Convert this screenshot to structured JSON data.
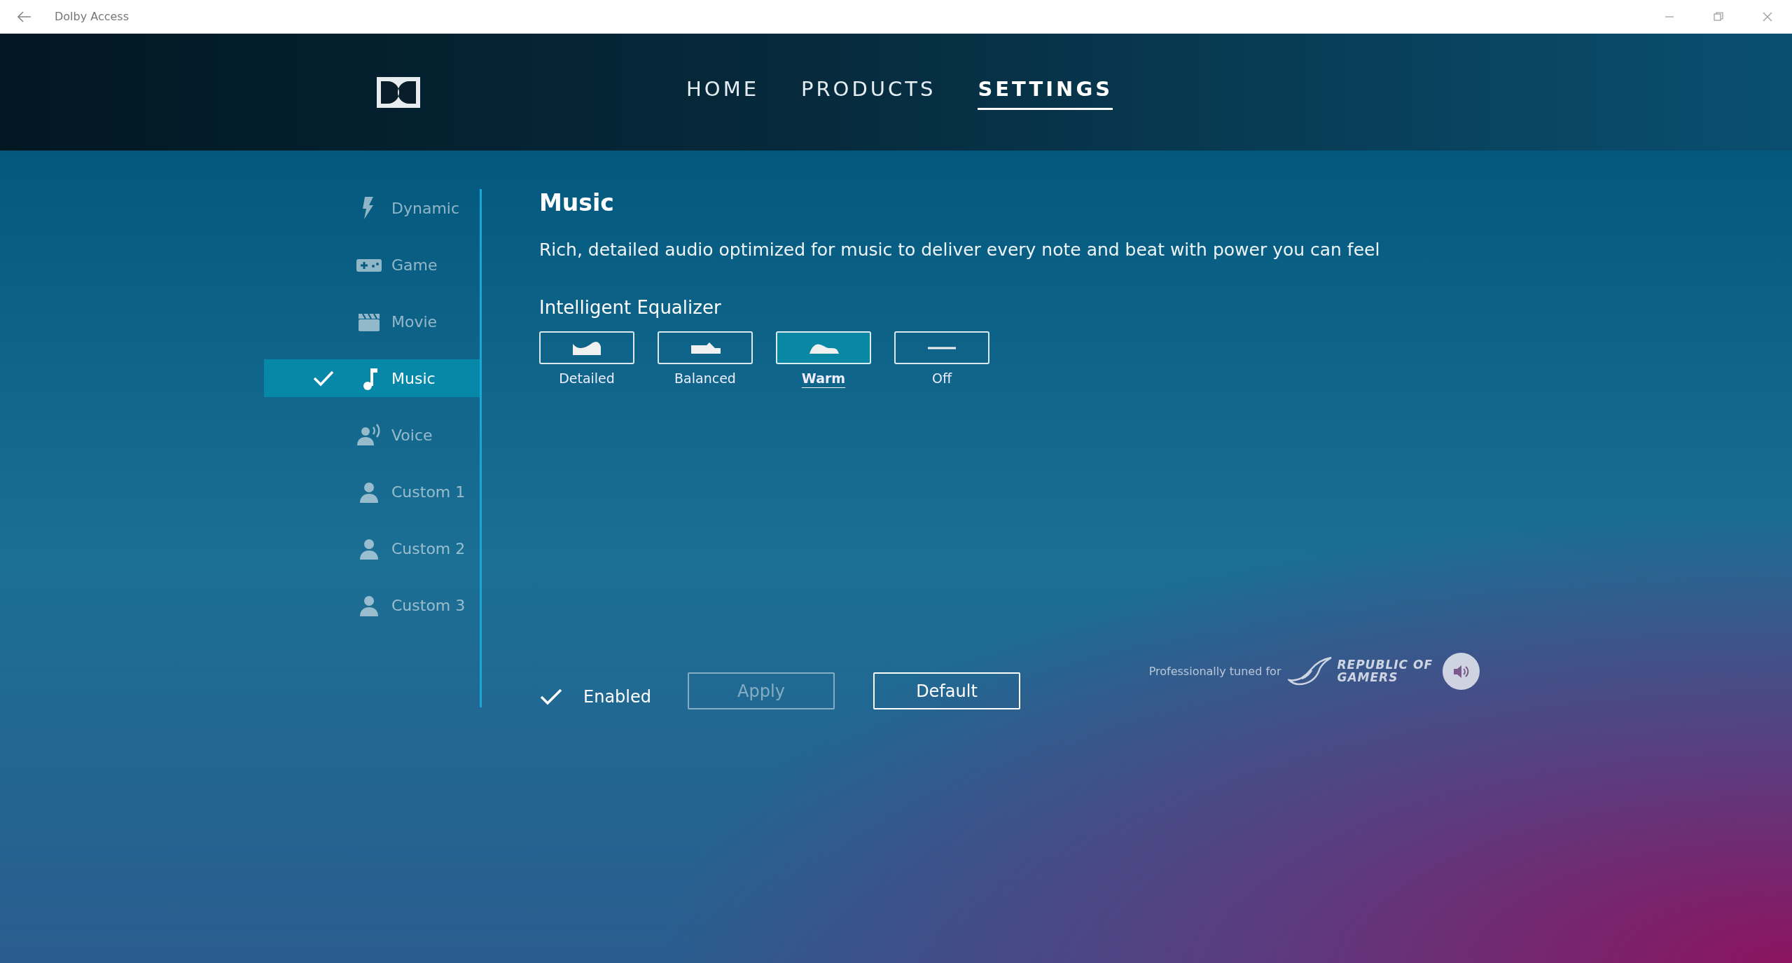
{
  "window": {
    "title": "Dolby Access"
  },
  "nav": [
    {
      "label": "HOME",
      "selected": false
    },
    {
      "label": "PRODUCTS",
      "selected": false
    },
    {
      "label": "SETTINGS",
      "selected": true
    }
  ],
  "sidebar": {
    "items": [
      {
        "label": "Dynamic",
        "kind": "bolt",
        "selected": false
      },
      {
        "label": "Game",
        "kind": "gamepad",
        "selected": false
      },
      {
        "label": "Movie",
        "kind": "clapper",
        "selected": false
      },
      {
        "label": "Music",
        "kind": "note",
        "selected": true
      },
      {
        "label": "Voice",
        "kind": "voice",
        "selected": false
      },
      {
        "label": "Custom 1",
        "kind": "person",
        "selected": false
      },
      {
        "label": "Custom 2",
        "kind": "person",
        "selected": false
      },
      {
        "label": "Custom 3",
        "kind": "person",
        "selected": false
      }
    ]
  },
  "profile": {
    "title": "Music",
    "description": "Rich, detailed audio optimized for music to deliver every note and beat with power you can feel"
  },
  "equalizer": {
    "label": "Intelligent Equalizer",
    "presets": [
      {
        "label": "Detailed",
        "kind": "detailed",
        "selected": false
      },
      {
        "label": "Balanced",
        "kind": "balanced",
        "selected": false
      },
      {
        "label": "Warm",
        "kind": "warm",
        "selected": true
      },
      {
        "label": "Off",
        "kind": "flat",
        "selected": false
      }
    ]
  },
  "enabled": {
    "label": "Enabled",
    "checked": true
  },
  "buttons": [
    {
      "label": "Apply",
      "disabled": true
    },
    {
      "label": "Default",
      "disabled": false
    }
  ],
  "tuning": {
    "text": "Professionally tuned for",
    "brand_lines": [
      "REPUBLIC OF",
      "GAMERS"
    ]
  }
}
